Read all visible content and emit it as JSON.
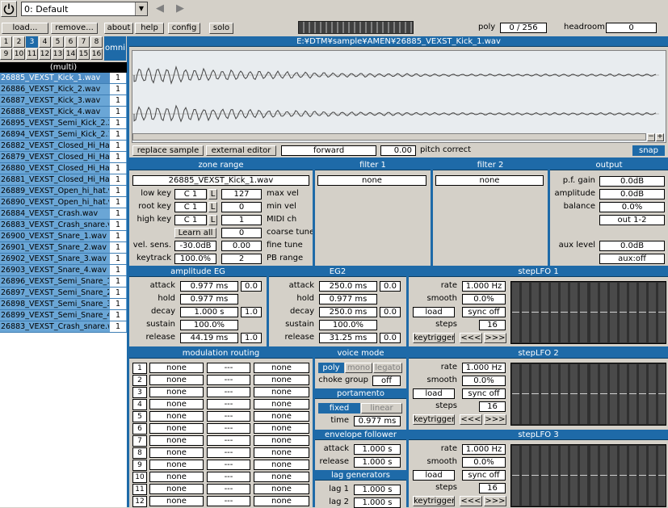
{
  "toolbar": {
    "preset": "0: Default",
    "load": "load...",
    "remove": "remove...",
    "about": "about",
    "help": "help",
    "config": "config",
    "solo": "solo",
    "poly_label": "poly",
    "poly_value": "0 / 256",
    "headroom_label": "headroom",
    "headroom_value": "0"
  },
  "parts": {
    "row1": [
      "1",
      "2",
      "3",
      "4",
      "5",
      "6",
      "7",
      "8"
    ],
    "row2": [
      "9",
      "10",
      "11",
      "12",
      "13",
      "14",
      "15",
      "16"
    ],
    "omni": "omni",
    "selected": "3"
  },
  "program_label": "(multi)",
  "samples": [
    {
      "name": "26885_VEXST_Kick_1.wav",
      "n": "1"
    },
    {
      "name": "26886_VEXST_Kick_2.wav",
      "n": "1"
    },
    {
      "name": "26887_VEXST_Kick_3.wav",
      "n": "1"
    },
    {
      "name": "26888_VEXST_Kick_4.wav",
      "n": "1"
    },
    {
      "name": "26895_VEXST_Semi_Kick_2.2",
      "n": "1"
    },
    {
      "name": "26894_VEXST_Semi_Kick_2.1",
      "n": "1"
    },
    {
      "name": "26882_VEXST_Closed_Hi_Hat",
      "n": "1"
    },
    {
      "name": "26879_VEXST_Closed_Hi_Hat",
      "n": "1"
    },
    {
      "name": "26880_VEXST_Closed_Hi_Hat",
      "n": "1"
    },
    {
      "name": "26881_VEXST_Closed_Hi_Hat",
      "n": "1"
    },
    {
      "name": "26889_VEXST_Open_hi_hat.v",
      "n": "1"
    },
    {
      "name": "26890_VEXST_Open_hi_hat.v",
      "n": "1"
    },
    {
      "name": "26884_VEXST_Crash.wav",
      "n": "1"
    },
    {
      "name": "26883_VEXST_Crash_snare.v",
      "n": "1"
    },
    {
      "name": "26900_VEXST_Snare_1.wav",
      "n": "1"
    },
    {
      "name": "26901_VEXST_Snare_2.wav",
      "n": "1"
    },
    {
      "name": "26902_VEXST_Snare_3.wav",
      "n": "1"
    },
    {
      "name": "26903_VEXST_Snare_4.wav",
      "n": "1"
    },
    {
      "name": "26896_VEXST_Semi_Snare_1",
      "n": "1"
    },
    {
      "name": "26897_VEXST_Semi_Snare_2",
      "n": "1"
    },
    {
      "name": "26898_VEXST_Semi_Snare_3",
      "n": "1"
    },
    {
      "name": "26899_VEXST_Semi_Snare_4",
      "n": "1"
    },
    {
      "name": "26883_VEXST_Crash_snare.w",
      "n": "1"
    }
  ],
  "wave": {
    "path": "E:¥DTM¥sample¥AMEN¥26885_VEXST_Kick_1.wav",
    "replace": "replace sample",
    "external": "external editor",
    "mode": "forward",
    "pitch_value": "0.00",
    "pitch_label": "pitch correct",
    "snap": "snap"
  },
  "zone": {
    "title": "zone range",
    "file": "26885_VEXST_Kick_1.wav",
    "low_key_label": "low key",
    "low_key": "C 1",
    "root_key_label": "root key",
    "root_key": "C 1",
    "high_key_label": "high key",
    "high_key": "C 1",
    "l": "L",
    "max_vel": "127",
    "max_vel_label": "max vel",
    "min_vel": "0",
    "min_vel_label": "min vel",
    "midi_ch": "1",
    "midi_ch_label": "MIDI ch",
    "learn_all": "Learn all",
    "coarse": "0",
    "coarse_label": "coarse tune",
    "vel_sens_label": "vel. sens.",
    "vel_sens": "-30.0dB",
    "fine": "0.00",
    "fine_label": "fine tune",
    "keytrack_label": "keytrack",
    "keytrack": "100.0%",
    "pb": "2",
    "pb_label": "PB range"
  },
  "filter1": {
    "title": "filter 1",
    "type": "none"
  },
  "filter2": {
    "title": "filter 2",
    "type": "none"
  },
  "output": {
    "title": "output",
    "pf_gain_label": "p.f. gain",
    "pf_gain": "0.0dB",
    "amplitude_label": "amplitude",
    "amplitude": "0.0dB",
    "balance_label": "balance",
    "balance": "0.0%",
    "out": "out 1-2",
    "aux_level_label": "aux level",
    "aux_level": "0.0dB",
    "aux": "aux:off"
  },
  "amp_eg": {
    "title": "amplitude EG",
    "attack_label": "attack",
    "attack": "0.977 ms",
    "attack_c": "0.0",
    "hold_label": "hold",
    "hold": "0.977 ms",
    "decay_label": "decay",
    "decay": "1.000 s",
    "decay_c": "1.0",
    "sustain_label": "sustain",
    "sustain": "100.0%",
    "release_label": "release",
    "release": "44.19 ms",
    "release_c": "1.0"
  },
  "eg2": {
    "title": "EG2",
    "attack_label": "attack",
    "attack": "250.0 ms",
    "attack_c": "0.0",
    "hold_label": "hold",
    "hold": "0.977 ms",
    "decay_label": "decay",
    "decay": "250.0 ms",
    "decay_c": "0.0",
    "sustain_label": "sustain",
    "sustain": "100.0%",
    "release_label": "release",
    "release": "31.25 ms",
    "release_c": "0.0"
  },
  "lfo1": {
    "title": "stepLFO 1",
    "rate_label": "rate",
    "rate": "1.000 Hz",
    "smooth_label": "smooth",
    "smooth": "0.0%",
    "load": "load",
    "sync": "sync off",
    "steps_label": "steps",
    "steps": "16",
    "keytrigger": "keytrigger",
    "prev": "<<<",
    "next": ">>>"
  },
  "lfo2": {
    "title": "stepLFO 2",
    "rate_label": "rate",
    "rate": "1.000 Hz",
    "smooth_label": "smooth",
    "smooth": "0.0%",
    "load": "load",
    "sync": "sync off",
    "steps_label": "steps",
    "steps": "16",
    "keytrigger": "keytrigger",
    "prev": "<<<",
    "next": ">>>"
  },
  "lfo3": {
    "title": "stepLFO 3",
    "rate_label": "rate",
    "rate": "1.000 Hz",
    "smooth_label": "smooth",
    "smooth": "0.0%",
    "load": "load",
    "sync": "sync off",
    "steps_label": "steps",
    "steps": "16",
    "keytrigger": "keytrigger",
    "prev": "<<<",
    "next": ">>>"
  },
  "modulation": {
    "title": "modulation routing",
    "rows": [
      {
        "n": "1",
        "src": "none",
        "amt": "---",
        "dst": "none"
      },
      {
        "n": "2",
        "src": "none",
        "amt": "---",
        "dst": "none"
      },
      {
        "n": "3",
        "src": "none",
        "amt": "---",
        "dst": "none"
      },
      {
        "n": "4",
        "src": "none",
        "amt": "---",
        "dst": "none"
      },
      {
        "n": "5",
        "src": "none",
        "amt": "---",
        "dst": "none"
      },
      {
        "n": "6",
        "src": "none",
        "amt": "---",
        "dst": "none"
      },
      {
        "n": "7",
        "src": "none",
        "amt": "---",
        "dst": "none"
      },
      {
        "n": "8",
        "src": "none",
        "amt": "---",
        "dst": "none"
      },
      {
        "n": "9",
        "src": "none",
        "amt": "---",
        "dst": "none"
      },
      {
        "n": "10",
        "src": "none",
        "amt": "---",
        "dst": "none"
      },
      {
        "n": "11",
        "src": "none",
        "amt": "---",
        "dst": "none"
      },
      {
        "n": "12",
        "src": "none",
        "amt": "---",
        "dst": "none"
      }
    ]
  },
  "voice": {
    "title": "voice mode",
    "poly": "poly",
    "mono": "mono",
    "legato": "legato",
    "choke_label": "choke group",
    "choke": "off"
  },
  "portamento": {
    "title": "portamento",
    "fixed": "fixed",
    "linear": "linear",
    "time_label": "time",
    "time": "0.977 ms"
  },
  "envf": {
    "title": "envelope follower",
    "attack_label": "attack",
    "attack": "1.000 s",
    "release_label": "release",
    "release": "1.000 s"
  },
  "lag": {
    "title": "lag generators",
    "lag1_label": "lag 1",
    "lag1": "1.000 s",
    "lag2_label": "lag 2",
    "lag2": "1.000 s"
  },
  "colors": {
    "accent": "#1e6aa8",
    "selected_row": "#6aa6d6",
    "panel": "#d4d0c8"
  }
}
